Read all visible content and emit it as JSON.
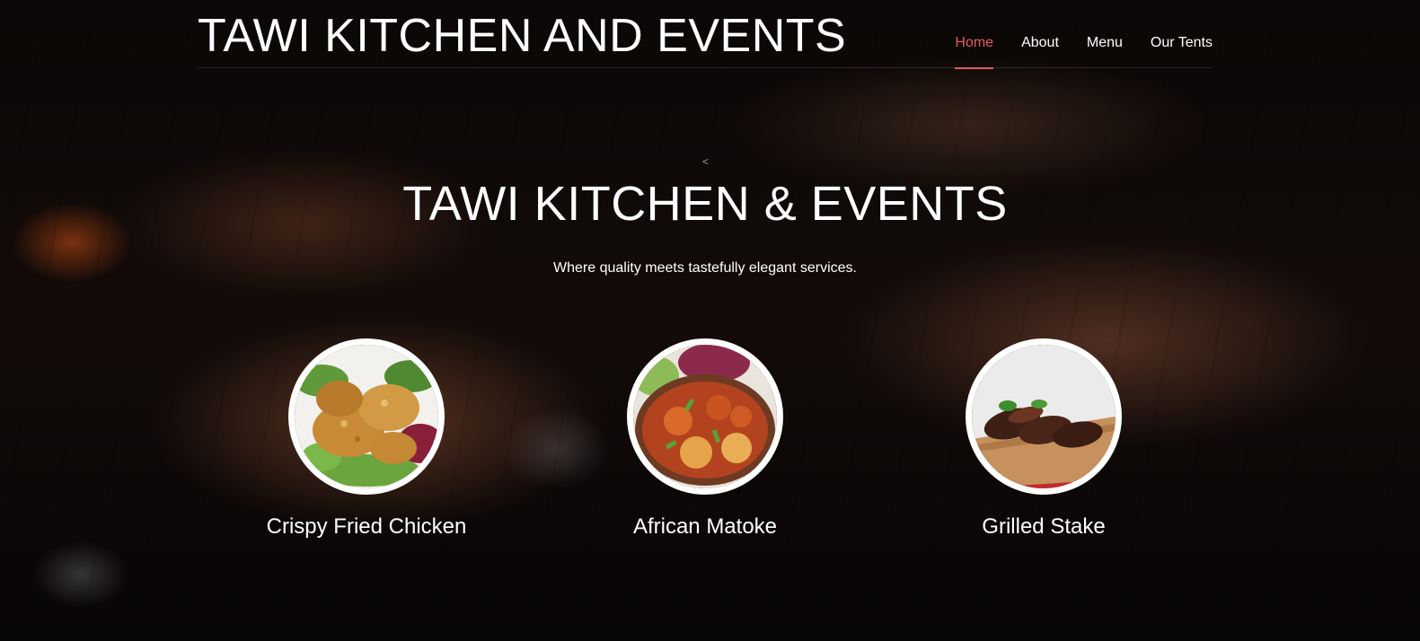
{
  "header": {
    "brand": "TAWI KITCHEN AND EVENTS",
    "nav": [
      {
        "label": "Home",
        "active": true
      },
      {
        "label": "About",
        "active": false
      },
      {
        "label": "Menu",
        "active": false
      },
      {
        "label": "Our Tents",
        "active": false
      }
    ]
  },
  "hero": {
    "prev_glyph": "<",
    "title": "TAWI KITCHEN & EVENTS",
    "subtitle": "Where quality meets tastefully elegant services."
  },
  "dishes": [
    {
      "name": "Crispy Fried Chicken",
      "image": "fried-chicken-image"
    },
    {
      "name": "African Matoke",
      "image": "matoke-image"
    },
    {
      "name": "Grilled Stake",
      "image": "grilled-steak-image"
    }
  ],
  "colors": {
    "accent": "#e35a5a",
    "text": "#ffffff",
    "background": "#0a0605"
  }
}
